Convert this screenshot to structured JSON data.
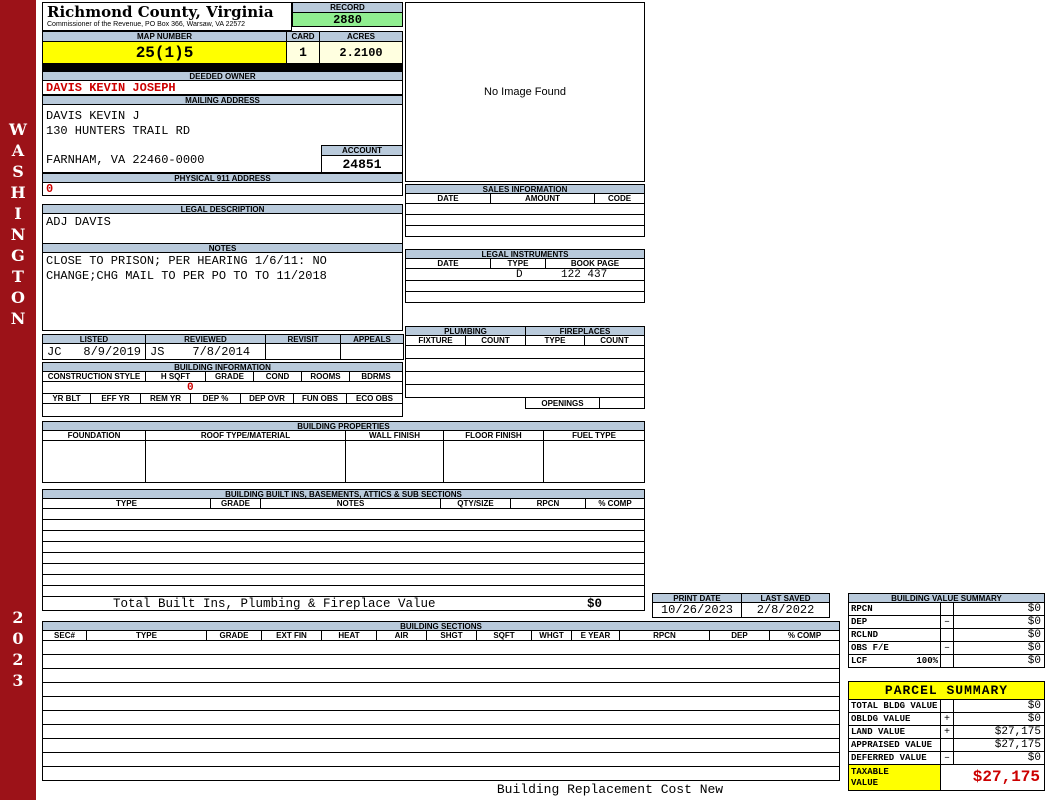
{
  "sidebar": {
    "district": "WASHINGTON",
    "year": "2023"
  },
  "header": {
    "county_title": "Richmond County, Virginia",
    "office_line": "Commissioner of the Revenue, PO Box 366, Warsaw, VA 22572",
    "record_label": "RECORD",
    "record_value": "2880",
    "map_number_label": "MAP NUMBER",
    "map_number_value": "25(1)5",
    "card_label": "CARD",
    "card_value": "1",
    "acres_label": "ACRES",
    "acres_value": "2.2100"
  },
  "owner": {
    "deeded_owner_label": "DEEDED OWNER",
    "deeded_owner": "DAVIS KEVIN JOSEPH",
    "mailing_address_label": "MAILING ADDRESS",
    "mailing_line1": "DAVIS KEVIN J",
    "mailing_line2": "130 HUNTERS TRAIL RD",
    "mailing_line3": "FARNHAM, VA 22460-0000",
    "account_label": "ACCOUNT",
    "account_value": "24851",
    "physical_address_label": "PHYSICAL 911 ADDRESS",
    "physical_address_value": "0",
    "legal_description_label": "LEGAL DESCRIPTION",
    "legal_description": "ADJ DAVIS",
    "notes_label": "NOTES",
    "notes_line1": "CLOSE TO PRISON; PER HEARING 1/6/11: NO",
    "notes_line2": "CHANGE;CHG MAIL TO PER PO TO TO 11/2018"
  },
  "image_box": {
    "placeholder": "No Image Found"
  },
  "sales": {
    "label": "SALES INFORMATION",
    "columns": [
      "DATE",
      "AMOUNT",
      "CODE"
    ]
  },
  "legal_instruments": {
    "label": "LEGAL INSTRUMENTS",
    "columns": [
      "DATE",
      "TYPE",
      "BOOK PAGE"
    ],
    "row1": {
      "type": "D",
      "book_page": "122 437"
    }
  },
  "plumbing_fireplaces": {
    "plumbing_label": "PLUMBING",
    "fireplaces_label": "FIREPLACES",
    "columns": [
      "FIXTURE",
      "COUNT",
      "TYPE",
      "COUNT"
    ],
    "openings_label": "OPENINGS"
  },
  "review": {
    "listed_label": "LISTED",
    "reviewed_label": "REVIEWED",
    "revisit_label": "REVISIT",
    "appeals_label": "APPEALS",
    "listed_by": "JC",
    "listed_date": "8/9/2019",
    "reviewed_by": "JS",
    "reviewed_date": "7/8/2014"
  },
  "building_information": {
    "label": "BUILDING INFORMATION",
    "columns_row1": [
      "CONSTRUCTION STYLE",
      "H SQFT",
      "GRADE",
      "COND",
      "ROOMS",
      "BDRMS"
    ],
    "h_sqft_value": "0",
    "columns_row2": [
      "YR BLT",
      "EFF YR",
      "REM YR",
      "DEP %",
      "DEP OVR",
      "FUN OBS",
      "ECO OBS"
    ]
  },
  "building_properties": {
    "label": "BUILDING PROPERTIES",
    "columns": [
      "FOUNDATION",
      "ROOF TYPE/MATERIAL",
      "WALL FINISH",
      "FLOOR FINISH",
      "FUEL TYPE"
    ]
  },
  "built_ins": {
    "label": "BUILDING BUILT INS, BASEMENTS, ATTICS & SUB SECTIONS",
    "columns": [
      "TYPE",
      "GRADE",
      "NOTES",
      "QTY/SIZE",
      "RPCN",
      "% COMP"
    ],
    "total_label": "Total Built Ins, Plumbing & Fireplace Value",
    "total_value": "$0"
  },
  "print_info": {
    "print_date_label": "PRINT DATE",
    "print_date": "10/26/2023",
    "last_saved_label": "LAST SAVED",
    "last_saved": "2/8/2022"
  },
  "building_value_summary": {
    "label": "BUILDING VALUE SUMMARY",
    "rows": [
      {
        "label": "RPCN",
        "extra": "",
        "op": "",
        "value": "$0"
      },
      {
        "label": "DEP",
        "extra": "",
        "op": "–",
        "value": "$0"
      },
      {
        "label": "RCLND",
        "extra": "",
        "op": "",
        "value": "$0"
      },
      {
        "label": "OBS F/E",
        "extra": "",
        "op": "–",
        "value": "$0"
      },
      {
        "label": "LCF",
        "extra": "100%",
        "op": "",
        "value": "$0"
      }
    ]
  },
  "building_sections": {
    "label": "BUILDING SECTIONS",
    "columns": [
      "SEC#",
      "TYPE",
      "GRADE",
      "EXT FIN",
      "HEAT",
      "AIR",
      "SHGT",
      "SQFT",
      "WHGT",
      "E YEAR",
      "RPCN",
      "DEP",
      "% COMP"
    ]
  },
  "parcel_summary": {
    "title": "PARCEL SUMMARY",
    "rows": [
      {
        "label": "TOTAL BLDG VALUE",
        "op": "",
        "value": "$0"
      },
      {
        "label": "OBLDG VALUE",
        "op": "+",
        "value": "$0"
      },
      {
        "label": "LAND VALUE",
        "op": "+",
        "value": "$27,175"
      },
      {
        "label": "APPRAISED VALUE",
        "op": "",
        "value": "$27,175"
      },
      {
        "label": "DEFERRED VALUE",
        "op": "–",
        "value": "$0"
      }
    ],
    "taxable_label": "TAXABLE VALUE",
    "taxable_value": "$27,175"
  },
  "footer": {
    "note": "Building Replacement Cost New"
  },
  "colors": {
    "sidebar_maroon": "#9c1218",
    "header_bar_blue": "#b9cadb",
    "record_green": "#90ee90",
    "highlight_yellow": "#ffff00",
    "light_yellow": "#ffffe0",
    "value_red": "#cc0000"
  }
}
